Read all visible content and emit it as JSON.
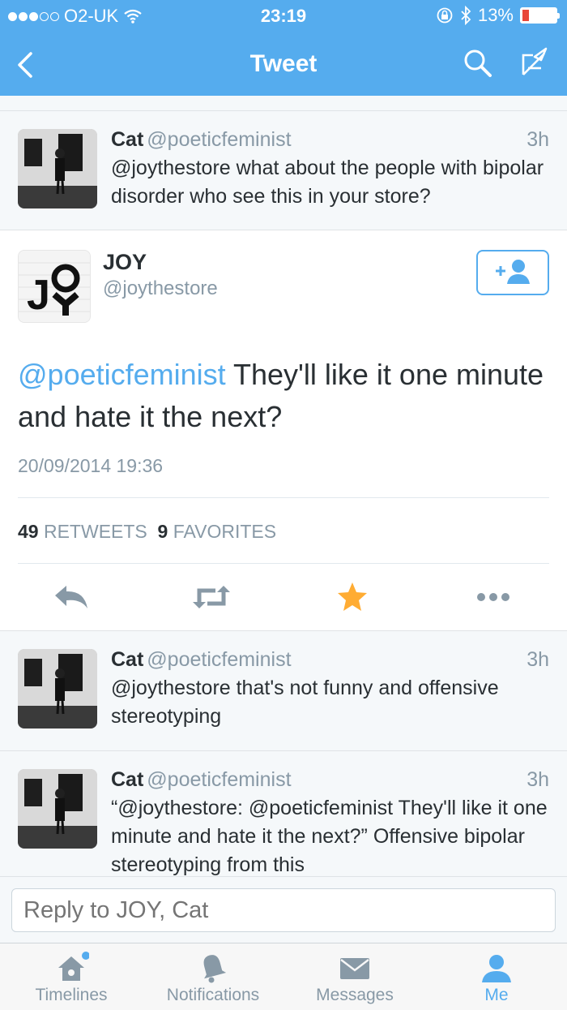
{
  "status_bar": {
    "carrier": "O2-UK",
    "time": "23:19",
    "battery": "13%"
  },
  "nav": {
    "title": "Tweet"
  },
  "replies_above": [
    {
      "name": "Cat",
      "handle": "@poeticfeminist",
      "time": "3h",
      "text": "@joythestore what about the people with bipolar disorder who see this in your store?"
    }
  ],
  "main_tweet": {
    "name": "JOY",
    "handle": "@joythestore",
    "mention": "@poeticfeminist",
    "text": "They'll like it one minute and hate it the next?",
    "date": "20/09/2014 19:36",
    "retweets_count": "49",
    "retweets_label": "RETWEETS",
    "favorites_count": "9",
    "favorites_label": "FAVORITES",
    "avatar_text": "JOY"
  },
  "replies_below": [
    {
      "name": "Cat",
      "handle": "@poeticfeminist",
      "time": "3h",
      "text": "@joythestore that's not funny and offensive stereotyping"
    },
    {
      "name": "Cat",
      "handle": "@poeticfeminist",
      "time": "3h",
      "text": "“@joythestore: @poeticfeminist They'll like it one minute and hate it the next?” Offensive bipolar stereotyping from this"
    }
  ],
  "reply_box": {
    "placeholder": "Reply to JOY, Cat"
  },
  "tabs": [
    {
      "label": "Timelines"
    },
    {
      "label": "Notifications"
    },
    {
      "label": "Messages"
    },
    {
      "label": "Me"
    }
  ],
  "colors": {
    "brand": "#55acee",
    "favorite": "#ffac33",
    "muted": "#8899a6"
  }
}
